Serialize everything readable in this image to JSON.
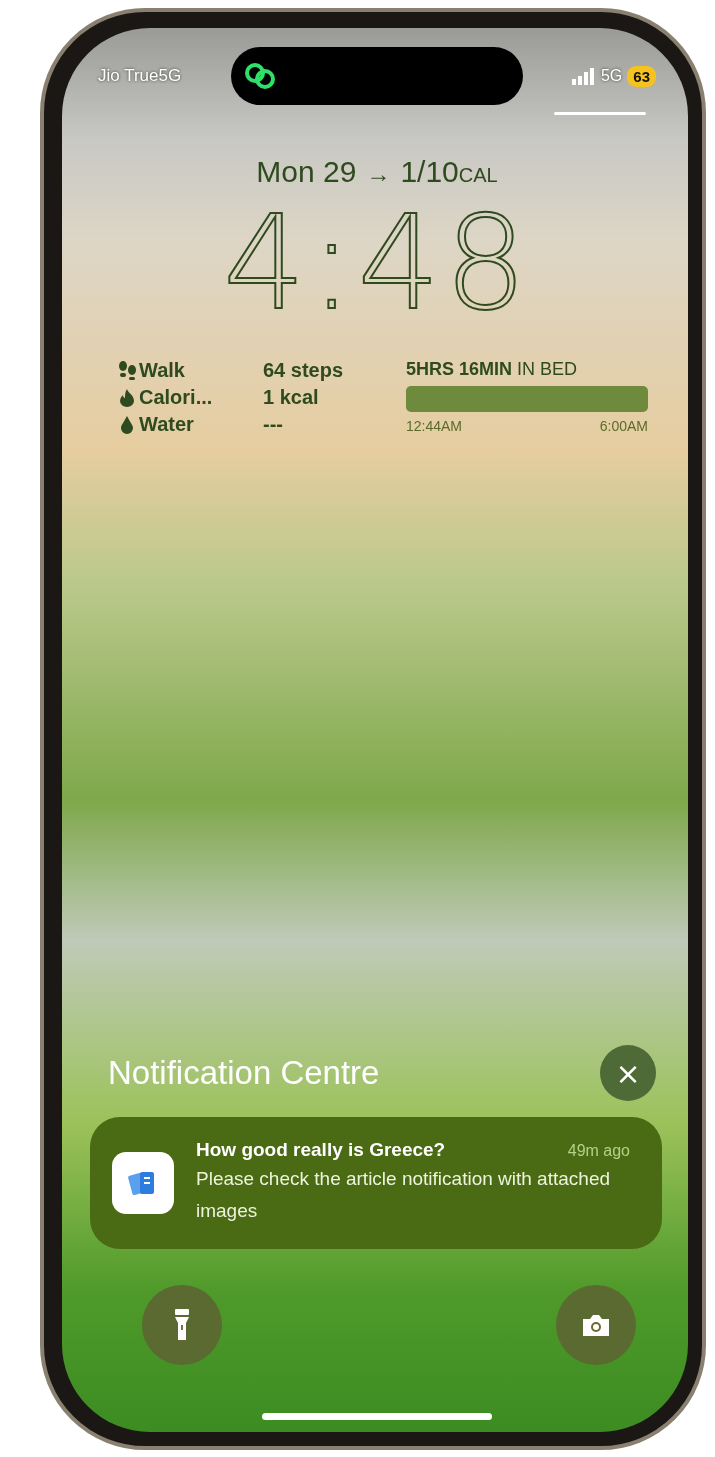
{
  "status_bar": {
    "carrier": "Jio True5G",
    "network": "5G",
    "battery": "63"
  },
  "date_line": {
    "date": "Mon 29",
    "arrow": "→",
    "event": "1/10",
    "event_suffix": "CAL"
  },
  "time": "4:48",
  "fitness_widget": {
    "rows": [
      {
        "kind": "walk",
        "label": "Walk",
        "value": "64 steps"
      },
      {
        "kind": "calories",
        "label": "Calori...",
        "value": "1 kcal"
      },
      {
        "kind": "water",
        "label": "Water",
        "value": "---"
      }
    ]
  },
  "sleep_widget": {
    "duration": "5HRS 16MIN",
    "suffix": "IN BED",
    "start": "12:44AM",
    "end": "6:00AM"
  },
  "notification_centre": {
    "title": "Notification Centre",
    "close": "×",
    "notifications": [
      {
        "title": "How good really is Greece?",
        "time": "49m ago",
        "body": "Please check the article notification with attached images"
      }
    ]
  },
  "quick_actions": [
    {
      "kind": "flashlight"
    },
    {
      "kind": "camera"
    }
  ]
}
